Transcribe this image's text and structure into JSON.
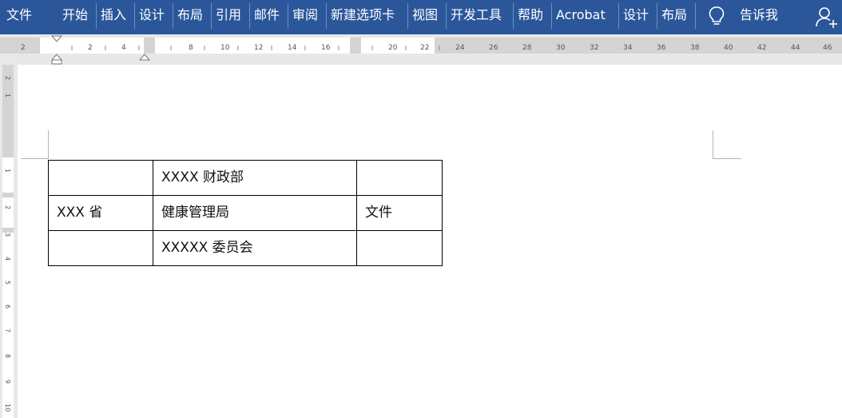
{
  "ribbon": {
    "tabs": [
      {
        "id": "file",
        "label": "文件"
      },
      {
        "id": "home",
        "label": "开始"
      },
      {
        "id": "insert",
        "label": "插入"
      },
      {
        "id": "design",
        "label": "设计"
      },
      {
        "id": "layout",
        "label": "布局"
      },
      {
        "id": "references",
        "label": "引用"
      },
      {
        "id": "mailings",
        "label": "邮件"
      },
      {
        "id": "review",
        "label": "审阅"
      },
      {
        "id": "new-tab",
        "label": "新建选项卡"
      },
      {
        "id": "view",
        "label": "视图"
      },
      {
        "id": "developer",
        "label": "开发工具"
      },
      {
        "id": "help",
        "label": "帮助"
      },
      {
        "id": "acrobat",
        "label": "Acrobat"
      },
      {
        "id": "table-design",
        "label": "设计"
      },
      {
        "id": "table-layout",
        "label": "布局"
      }
    ],
    "tell_me": "告诉我",
    "colors": {
      "ribbon_bg": "#2b579a",
      "ribbon_text": "#ffffff"
    }
  },
  "ruler": {
    "horizontal_labels": [
      "2",
      "2",
      "4",
      "8",
      "10",
      "12",
      "14",
      "16",
      "20",
      "22",
      "24",
      "26",
      "28",
      "30",
      "32",
      "34",
      "36",
      "38",
      "40",
      "42",
      "44",
      "46"
    ],
    "vertical_labels": [
      "2",
      "1",
      "1",
      "2",
      "3",
      "4",
      "5",
      "6",
      "7",
      "8",
      "9",
      "10"
    ]
  },
  "document": {
    "table": [
      [
        "",
        "XXXX 财政部",
        ""
      ],
      [
        "XXX 省",
        "健康管理局",
        "文件"
      ],
      [
        "",
        "XXXXX 委员会",
        ""
      ]
    ]
  }
}
